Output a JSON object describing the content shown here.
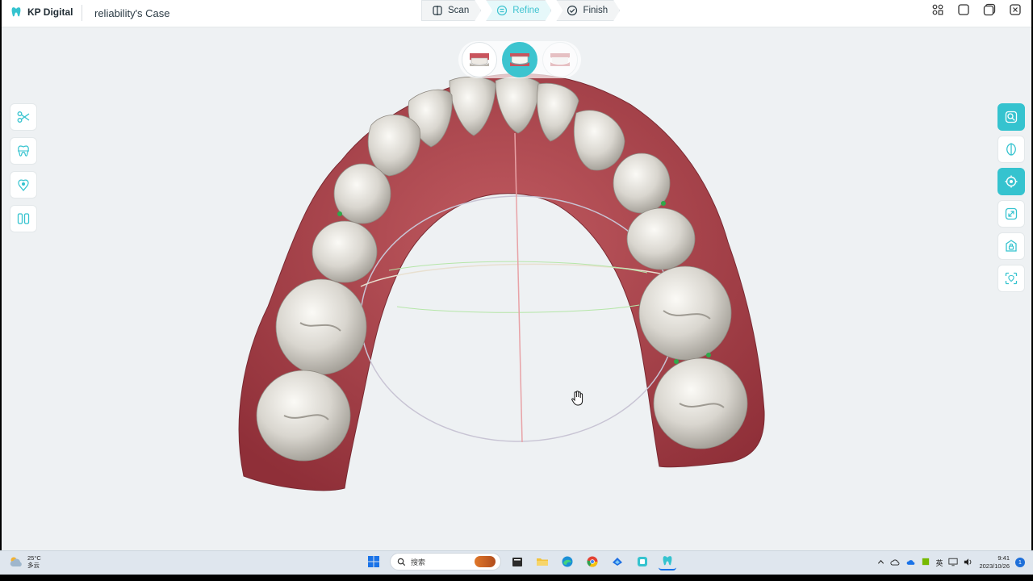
{
  "app": {
    "brand": "KP Digital",
    "case_title": "reliability's Case",
    "accent": "#35c3cf"
  },
  "steps": [
    {
      "label": "Scan",
      "icon": "scan-icon",
      "active": false
    },
    {
      "label": "Refine",
      "icon": "refine-icon",
      "active": true
    },
    {
      "label": "Finish",
      "icon": "check-circle-icon",
      "active": false
    }
  ],
  "window_controls": [
    "apps-grid-icon",
    "minimize-icon",
    "restore-icon",
    "close-icon"
  ],
  "jaw_switch": [
    {
      "name": "upper-jaw",
      "icon": "upper-jaw-icon",
      "state": "normal"
    },
    {
      "name": "lower-jaw",
      "icon": "lower-jaw-icon",
      "state": "active"
    },
    {
      "name": "both-jaws",
      "icon": "both-jaws-icon",
      "state": "dim"
    }
  ],
  "left_tools": [
    "scissors-icon",
    "tooth-icon",
    "margin-line-icon",
    "split-view-icon"
  ],
  "right_tools": [
    {
      "icon": "focus-tooth-icon",
      "active": true
    },
    {
      "icon": "half-tooth-icon",
      "active": false
    },
    {
      "icon": "target-icon",
      "active": true
    },
    {
      "icon": "expand-icon",
      "active": false
    },
    {
      "icon": "lock-tooth-icon",
      "active": false
    },
    {
      "icon": "scan-frame-icon",
      "active": false
    }
  ],
  "taskbar": {
    "weather_temp": "25°C",
    "weather_desc": "多云",
    "search_placeholder": "搜索",
    "ime": "英",
    "time": "9:41",
    "date": "2023/10/26",
    "notifications": "1",
    "pinned": [
      "windows-start-icon",
      "file-explorer-icon",
      "folder-icon",
      "edge-browser-icon",
      "chrome-icon",
      "store-icon",
      "app-icon",
      "kp-digital-icon"
    ]
  }
}
